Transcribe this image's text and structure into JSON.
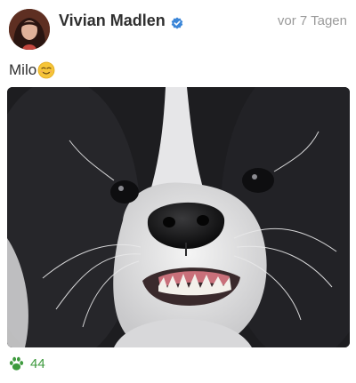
{
  "post": {
    "author": {
      "name": "Vivian Madlen",
      "verified_icon": "verified-badge-icon",
      "avatar_icon": "profile-avatar"
    },
    "timestamp": "vor 7 Tagen",
    "caption": {
      "text": "Milo",
      "emoji_icon": "relieved-smile-emoji-icon"
    },
    "photo_icon": "dog-photo",
    "reactions": {
      "icon": "paw-icon",
      "count": "44"
    }
  },
  "colors": {
    "verified_blue": "#3b86d8",
    "like_green": "#3d9a3d",
    "timestamp_gray": "#9a9a9a",
    "text_dark": "#2f2f2f"
  }
}
